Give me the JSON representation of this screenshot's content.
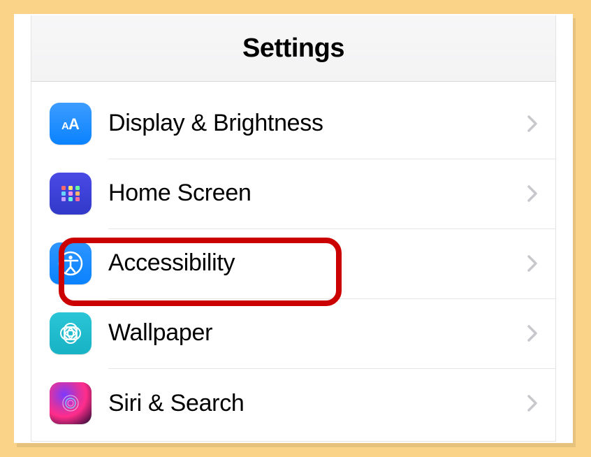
{
  "header": {
    "title": "Settings"
  },
  "rows": {
    "r0": {
      "label": "Display & Brightness"
    },
    "r1": {
      "label": "Home Screen"
    },
    "r2": {
      "label": "Accessibility"
    },
    "r3": {
      "label": "Wallpaper"
    },
    "r4": {
      "label": "Siri & Search"
    }
  }
}
